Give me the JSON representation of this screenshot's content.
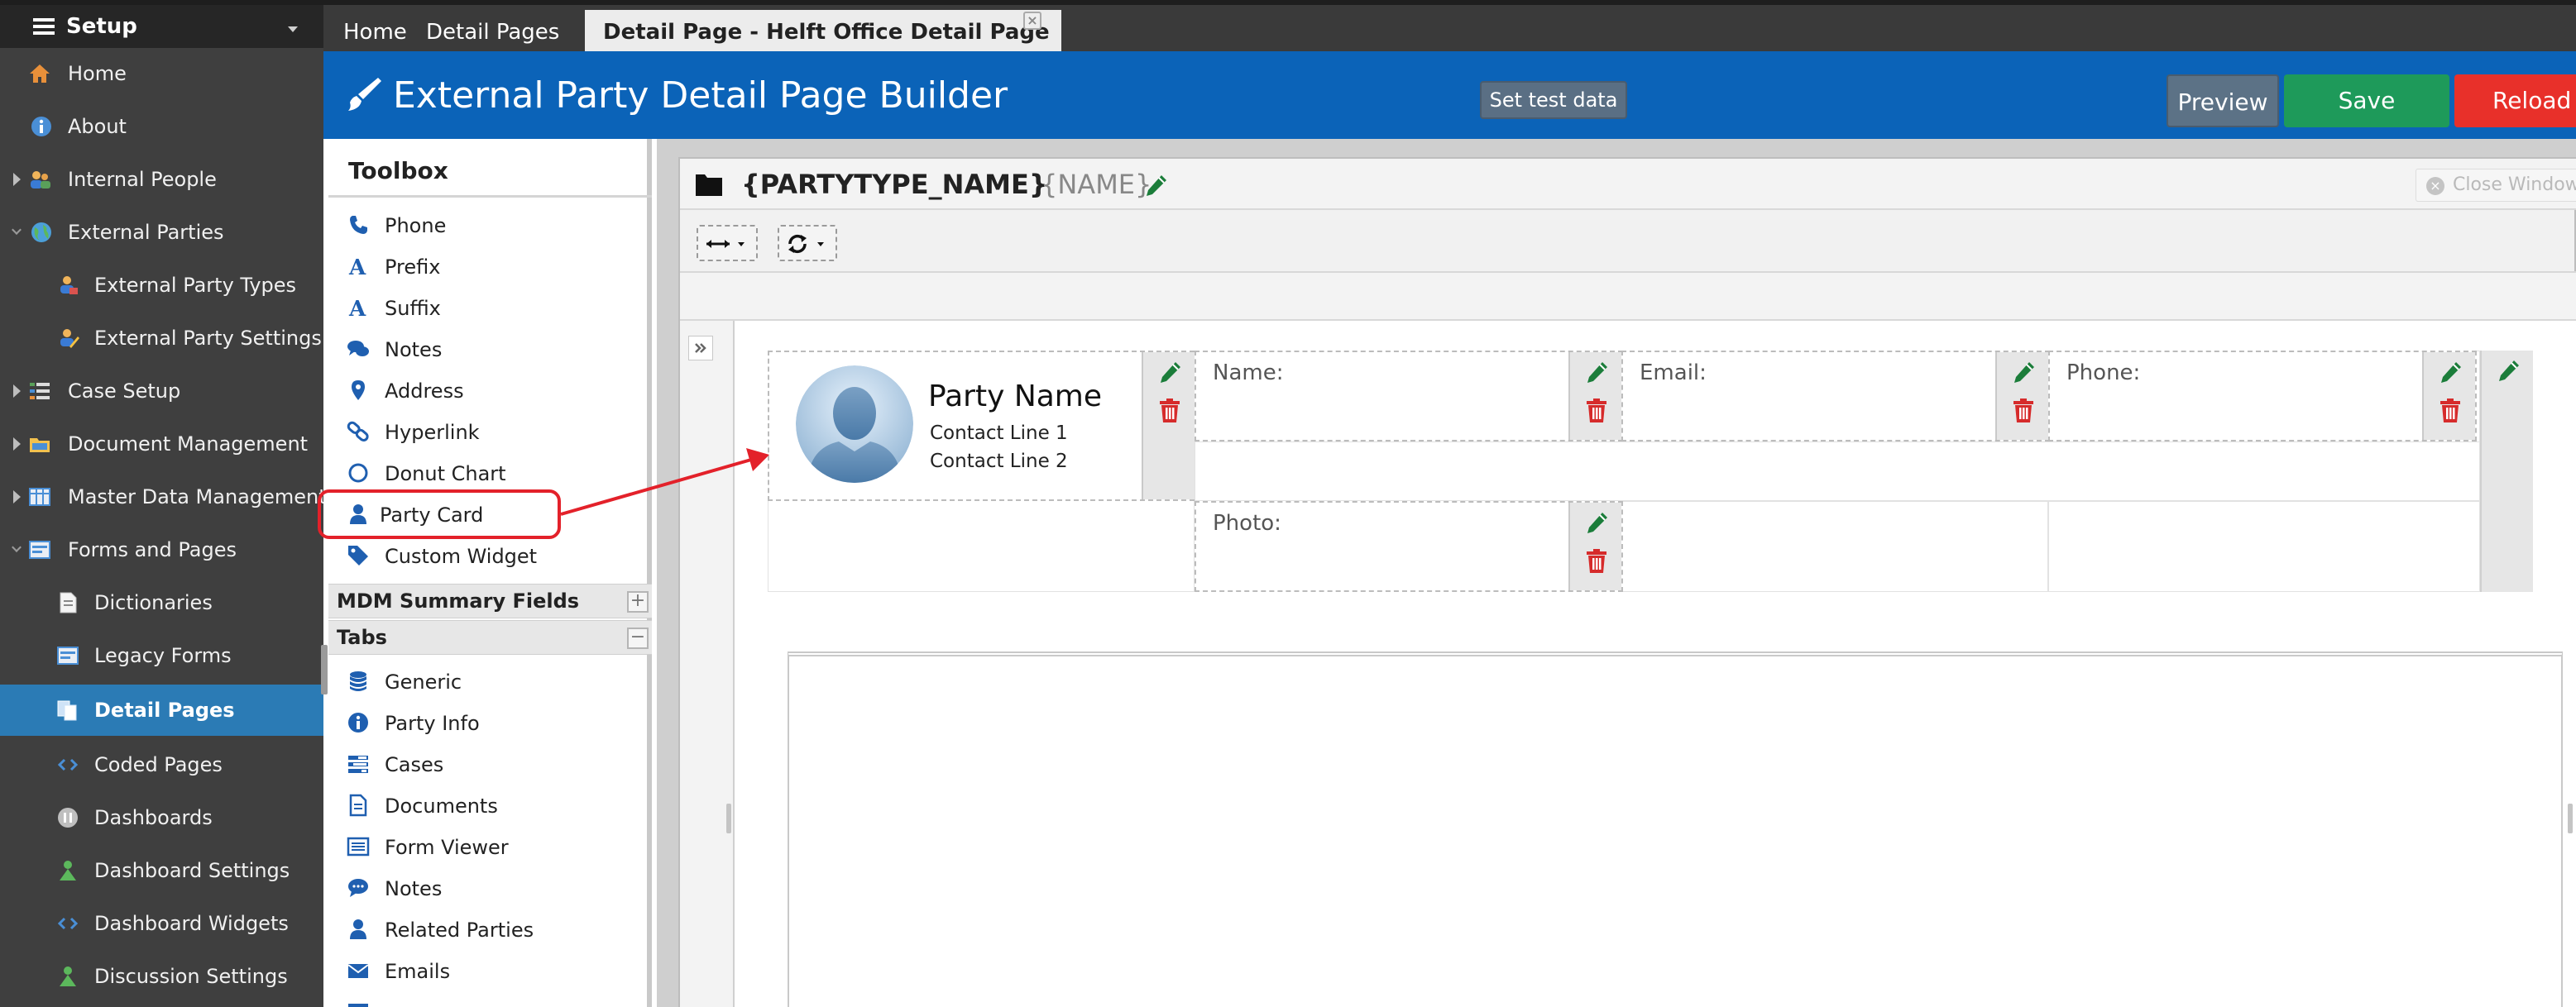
{
  "sidebar": {
    "title": "Setup",
    "items": [
      {
        "label": "Home",
        "icon": "home-icon"
      },
      {
        "label": "About",
        "icon": "info-icon"
      },
      {
        "label": "Internal People",
        "icon": "people-icon"
      },
      {
        "label": "External Parties",
        "icon": "globe-icon"
      },
      {
        "label": "External Party Types",
        "icon": "party-types-icon"
      },
      {
        "label": "External Party Settings",
        "icon": "party-settings-icon"
      },
      {
        "label": "Case Setup",
        "icon": "case-setup-icon"
      },
      {
        "label": "Document Management",
        "icon": "folder-icon"
      },
      {
        "label": "Master Data Management",
        "icon": "grid-icon"
      },
      {
        "label": "Forms and Pages",
        "icon": "form-icon"
      },
      {
        "label": "Dictionaries",
        "icon": "document-icon"
      },
      {
        "label": "Legacy Forms",
        "icon": "legacy-form-icon"
      },
      {
        "label": "Detail Pages",
        "icon": "pages-icon"
      },
      {
        "label": "Coded Pages",
        "icon": "code-icon"
      },
      {
        "label": "Dashboards",
        "icon": "dashboard-icon"
      },
      {
        "label": "Dashboard Settings",
        "icon": "dashboard-settings-icon"
      },
      {
        "label": "Dashboard Widgets",
        "icon": "code-icon"
      },
      {
        "label": "Discussion Settings",
        "icon": "discussion-settings-icon"
      }
    ]
  },
  "tabs": [
    {
      "label": "Home"
    },
    {
      "label": "Detail Pages",
      "close": "×"
    },
    {
      "label": "Detail Page - Helft Office Detail Page",
      "close": "×"
    }
  ],
  "header": {
    "title": "External Party Detail Page Builder",
    "set_test_data": "Set test data",
    "preview": "Preview",
    "save": "Save",
    "reload": "Reload"
  },
  "toolbox": {
    "title": "Toolbox",
    "items": [
      {
        "label": "Phone",
        "icon": "phone-icon"
      },
      {
        "label": "Prefix",
        "icon": "font-icon"
      },
      {
        "label": "Suffix",
        "icon": "font-icon"
      },
      {
        "label": "Notes",
        "icon": "comments-icon"
      },
      {
        "label": "Address",
        "icon": "map-marker-icon"
      },
      {
        "label": "Hyperlink",
        "icon": "link-icon"
      },
      {
        "label": "Donut Chart",
        "icon": "circle-icon"
      },
      {
        "label": "Party Card",
        "icon": "user-icon"
      },
      {
        "label": "Custom Widget",
        "icon": "tag-icon"
      }
    ],
    "mdm_group": {
      "label": "MDM Summary Fields",
      "toggle": "+"
    },
    "tabs_group": {
      "label": "Tabs",
      "toggle": "−"
    },
    "tab_items": [
      {
        "label": "Generic",
        "icon": "database-icon"
      },
      {
        "label": "Party Info",
        "icon": "info-icon"
      },
      {
        "label": "Cases",
        "icon": "tasks-icon"
      },
      {
        "label": "Documents",
        "icon": "file-icon"
      },
      {
        "label": "Form Viewer",
        "icon": "list-icon"
      },
      {
        "label": "Notes",
        "icon": "comment-icon"
      },
      {
        "label": "Related Parties",
        "icon": "user-icon"
      },
      {
        "label": "Emails",
        "icon": "envelope-icon"
      }
    ]
  },
  "panel": {
    "title": "{PARTYTYPE_NAME}",
    "subtitle": "{NAME}",
    "close_window": "Close Window"
  },
  "party_card": {
    "name": "Party Name",
    "line1": "Contact Line 1",
    "line2": "Contact Line 2"
  },
  "fields": {
    "name": "Name:",
    "email": "Email:",
    "phone": "Phone:",
    "photo": "Photo:"
  },
  "colors": {
    "header_blue": "#0b63b8",
    "save_green": "#1e9a5a",
    "reload_red": "#e8302a",
    "active_nav": "#2b7bb5",
    "edit_green": "#1b7d3a",
    "delete_red": "#d62b2b",
    "annotation_red": "#e3212a"
  }
}
